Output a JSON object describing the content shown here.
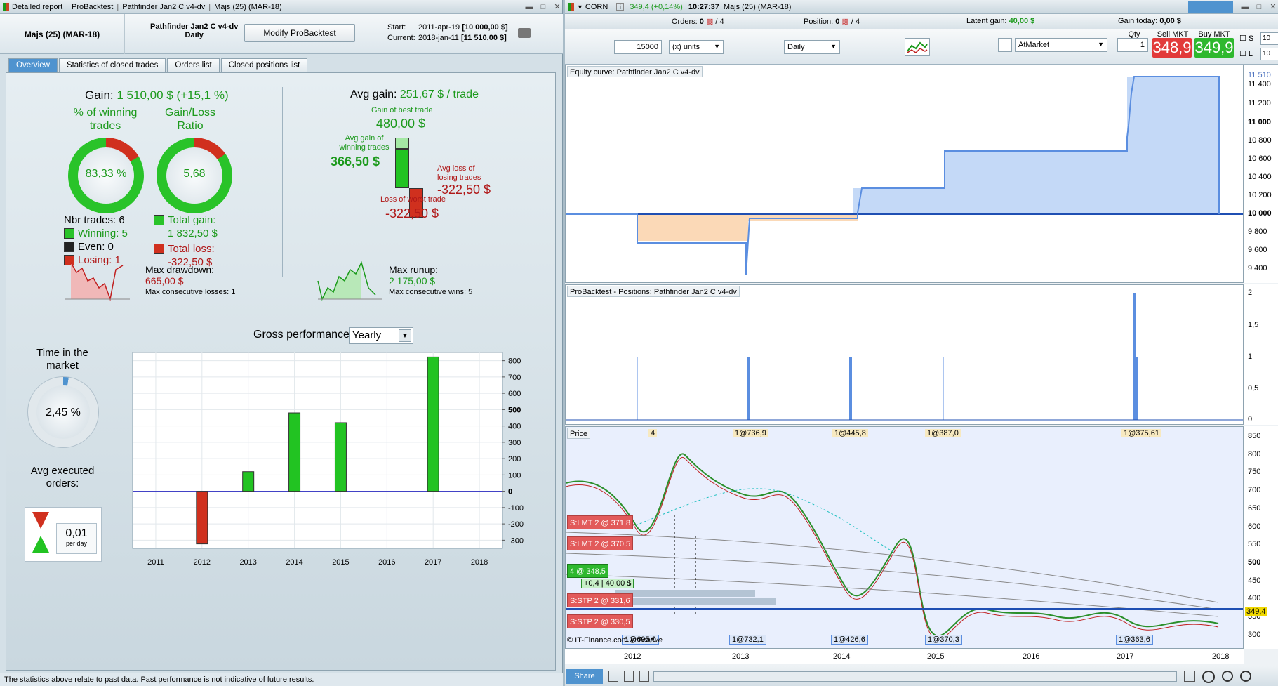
{
  "left_window": {
    "title_parts": [
      "Detailed report",
      "ProBacktest",
      "Pathfinder Jan2 C v4-dv",
      "Majs (25) (MAR-18)"
    ],
    "instrument": "Majs (25) (MAR-18)",
    "system_name": "Pathfinder Jan2 C v4-dv",
    "timeframe": "Daily",
    "modify_button": "Modify ProBacktest",
    "start_label": "Start:",
    "start_date": "2011-apr-19",
    "start_value": "[10 000,00 $]",
    "current_label": "Current:",
    "current_date": "2018-jan-11",
    "current_value": "[11 510,00 $]",
    "tabs": [
      "Overview",
      "Statistics of closed trades",
      "Orders list",
      "Closed positions list"
    ],
    "gain_label": "Gain:",
    "gain_value": "1 510,00 $ (+15,1 %)",
    "winning_label": "% of winning trades",
    "winning_value": "83,33 %",
    "ratio_label": "Gain/Loss Ratio",
    "ratio_value": "5,68",
    "nbr_trades": "Nbr trades: 6",
    "winning": "Winning: 5",
    "even": "Even: 0",
    "losing": "Losing: 1",
    "total_gain_label": "Total gain:",
    "total_gain_value": "1 832,50 $",
    "total_loss_label": "Total loss:",
    "total_loss_value": "-322,50 $",
    "avg_gain_label": "Avg gain:",
    "avg_gain_value": "251,67 $ / trade",
    "best_trade_label": "Gain of best trade",
    "best_trade_value": "480,00 $",
    "avg_win_label": "Avg gain of winning trades",
    "avg_win_value": "366,50 $",
    "avg_loss_label": "Avg loss of losing trades",
    "avg_loss_value": "-322,50 $",
    "worst_trade_label": "Loss of worst trade",
    "worst_trade_value": "-322,50 $",
    "max_drawdown_label": "Max drawdown:",
    "max_drawdown_value": "665,00 $",
    "max_consec_losses": "Max consecutive losses: 1",
    "max_runup_label": "Max runup:",
    "max_runup_value": "2 175,00 $",
    "max_consec_wins": "Max consecutive wins: 5",
    "time_market_label": "Time in the market",
    "time_market_value": "2,45 %",
    "avg_orders_label": "Avg executed orders:",
    "avg_orders_value": "0,01",
    "avg_orders_unit": "per day",
    "gross_perf_label": "Gross performance",
    "gross_perf_select": "Yearly",
    "status_text": "The statistics above relate to past data. Past performance is not indicative of future results."
  },
  "chart_data": {
    "type": "bar",
    "categories": [
      "2011",
      "2012",
      "2013",
      "2014",
      "2015",
      "2016",
      "2017",
      "2018"
    ],
    "values": [
      0,
      -322.5,
      120,
      480,
      420,
      0,
      822.5,
      0
    ],
    "ylim": [
      -350,
      850
    ],
    "yticks": [
      "800",
      "700",
      "600",
      "500",
      "400",
      "300",
      "200",
      "100",
      "0",
      "-100",
      "-200",
      "-300"
    ],
    "grid": true,
    "colors": {
      "positive": "#22c322",
      "negative": "#d0301e"
    }
  },
  "right_window": {
    "symbol": "CORN",
    "price_change": "349,4 (+0,14%)",
    "time": "10:27:37",
    "instrument": "Majs (25) (MAR-18)",
    "orders_label": "Orders:",
    "orders_value": "0",
    "orders_total": "/ 4",
    "position_label": "Position:",
    "position_value": "0",
    "position_total": "/ 4",
    "latent_label": "Latent gain:",
    "latent_value": "40,00 $",
    "today_label": "Gain today:",
    "today_value": "0,00 $",
    "qty_input": "15000",
    "units_select": "(x) units",
    "period_select": "Daily",
    "order_type": "AtMarket",
    "qty_label": "Qty",
    "qty_value": "1",
    "sell_label": "Sell MKT",
    "sell_price": "348,9",
    "buy_label": "Buy MKT",
    "buy_price": "349,9",
    "s_label": "S",
    "l_label": "L",
    "s_value": "10",
    "l_value": "10",
    "equity_title": "Equity curve: Pathfinder Jan2 C v4-dv",
    "equity_axis": [
      "11 510",
      "11 400",
      "11 200",
      "11 000",
      "10 800",
      "10 600",
      "10 400",
      "10 200",
      "10 000",
      "9 800",
      "9 600",
      "9 400"
    ],
    "positions_title": "ProBacktest - Positions: Pathfinder Jan2 C v4-dv",
    "positions_axis": [
      "2",
      "1,5",
      "1",
      "0,5",
      "0"
    ],
    "price_title": "Price",
    "price_axis": [
      "850",
      "800",
      "750",
      "700",
      "650",
      "600",
      "550",
      "500",
      "450",
      "400",
      "350",
      "300"
    ],
    "current_price": "349,4",
    "top_markers": [
      "4",
      "1@736,9",
      "1@445,8",
      "1@387,0",
      "1@375,61"
    ],
    "bottom_markers": [
      "1@695,0",
      "1@732,1",
      "1@426,6",
      "1@370,3",
      "1@363,6"
    ],
    "order_tags": [
      "S:LMT 2 @ 371,8",
      "S:LMT 2 @ 370,5",
      "4 @ 348,5",
      "S:STP 2 @ 331,6",
      "S:STP 2 @ 330,5"
    ],
    "pos_gain": "+0,4",
    "pos_gain_value": "40,00 $",
    "source": "© IT-Finance.com",
    "source_note": "indicative",
    "x_labels": [
      "2012",
      "2013",
      "2014",
      "2015",
      "2016",
      "2017",
      "2018"
    ],
    "share": "Share"
  }
}
